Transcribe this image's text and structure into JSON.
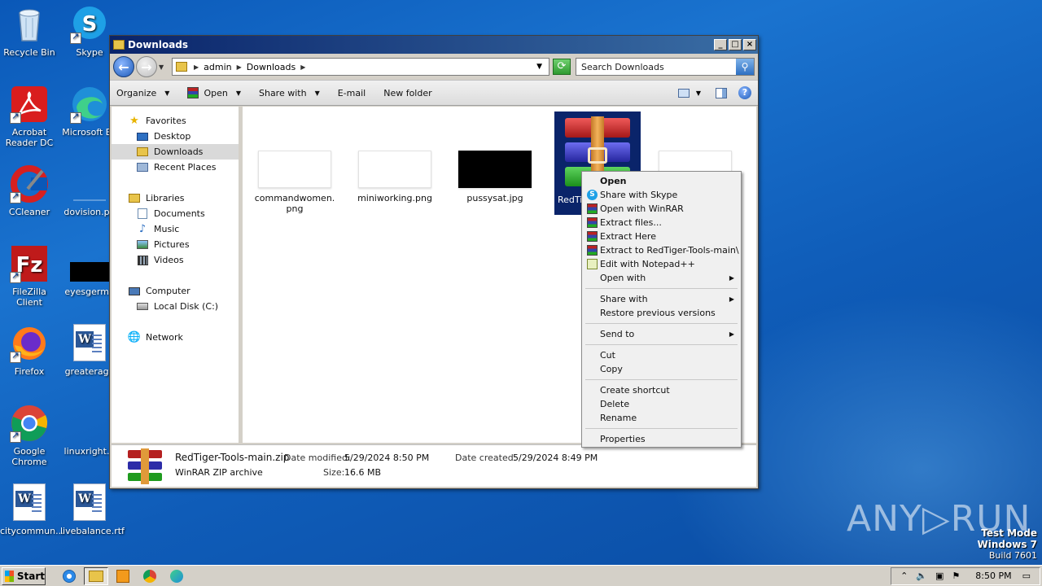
{
  "desktop": {
    "icons": [
      {
        "label": "Recycle Bin"
      },
      {
        "label": "Skype"
      },
      {
        "label": "Acrobat Reader DC"
      },
      {
        "label": "Microsoft Ed"
      },
      {
        "label": "CCleaner"
      },
      {
        "label": "dovision.pn"
      },
      {
        "label": "FileZilla Client"
      },
      {
        "label": "eyesgerma"
      },
      {
        "label": "Firefox"
      },
      {
        "label": "greaterage"
      },
      {
        "label": "Google Chrome"
      },
      {
        "label": "linuxright.p"
      },
      {
        "label": "citycommun..."
      },
      {
        "label": "livebalance.rtf"
      }
    ]
  },
  "window": {
    "title": "Downloads",
    "address": {
      "crumbs": [
        "admin",
        "Downloads"
      ]
    },
    "search_placeholder": "Search Downloads",
    "toolbar": {
      "organize": "Organize",
      "open": "Open",
      "share_with": "Share with",
      "email": "E-mail",
      "new_folder": "New folder"
    },
    "nav": {
      "favorites": "Favorites",
      "desktop": "Desktop",
      "downloads": "Downloads",
      "recent_places": "Recent Places",
      "libraries": "Libraries",
      "documents": "Documents",
      "music": "Music",
      "pictures": "Pictures",
      "videos": "Videos",
      "computer": "Computer",
      "local_disk": "Local Disk (C:)",
      "network": "Network"
    },
    "files": [
      {
        "name": "commandwomen.png"
      },
      {
        "name": "miniworking.png"
      },
      {
        "name": "pussysat.jpg"
      },
      {
        "name": "RedTi"
      }
    ],
    "status": {
      "filename": "RedTiger-Tools-main.zip",
      "date_modified_label": "Date modified:",
      "date_modified": "5/29/2024 8:50 PM",
      "date_created_label": "Date created:",
      "date_created": "5/29/2024 8:49 PM",
      "type": "WinRAR ZIP archive",
      "size_label": "Size:",
      "size": "16.6 MB"
    }
  },
  "context_menu": {
    "items": {
      "open": "Open",
      "share_skype": "Share with Skype",
      "open_winrar": "Open with WinRAR",
      "extract_files": "Extract files...",
      "extract_here": "Extract Here",
      "extract_to": "Extract to RedTiger-Tools-main\\",
      "edit_npp": "Edit with Notepad++",
      "open_with": "Open with",
      "share_with": "Share with",
      "restore": "Restore previous versions",
      "send_to": "Send to",
      "cut": "Cut",
      "copy": "Copy",
      "create_shortcut": "Create shortcut",
      "delete": "Delete",
      "rename": "Rename",
      "properties": "Properties"
    }
  },
  "taskbar": {
    "start": "Start",
    "clock": "8:50 PM"
  },
  "watermark": "ANY▷RUN",
  "testmode": {
    "line1": "Test Mode",
    "line2": "Windows 7",
    "line3": "Build 7601"
  }
}
